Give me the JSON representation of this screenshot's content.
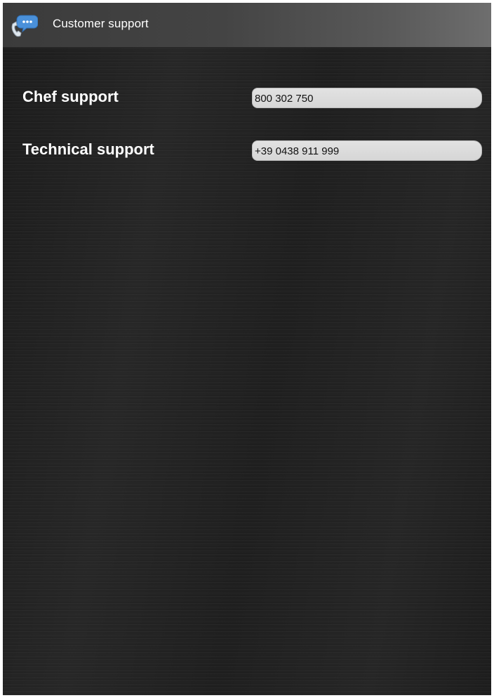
{
  "actionbar": {
    "title": "Customer support",
    "icon": "phone-chat-icon",
    "icon_colors": {
      "bubble": "#4a90d9",
      "handset": "#dfe7ee"
    }
  },
  "support": [
    {
      "label": "Chef support",
      "value": "800 302 750"
    },
    {
      "label": "Technical support",
      "value": "+39 0438 911 999"
    }
  ]
}
